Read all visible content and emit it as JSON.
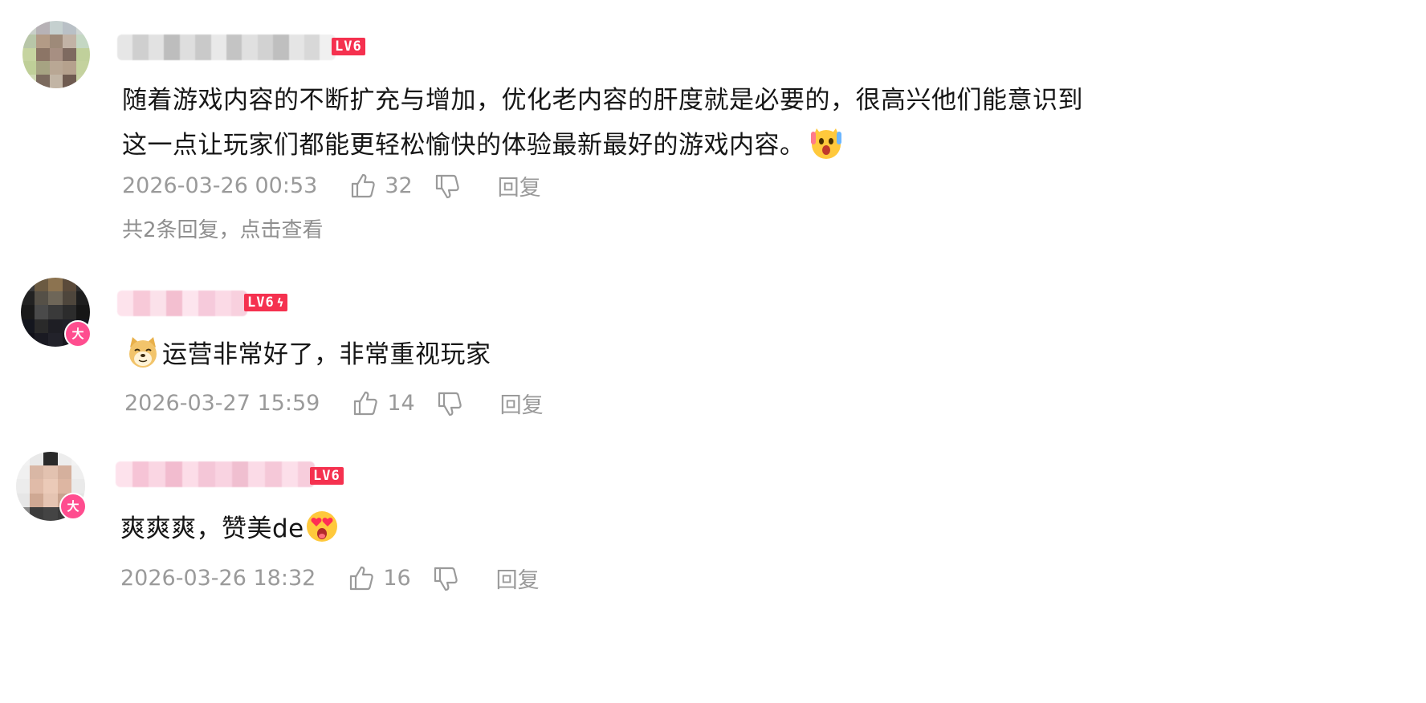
{
  "comments": [
    {
      "level": "LV6",
      "level_bolt": "",
      "big_badge": "",
      "text_lines": [
        "随着游戏内容的不断扩充与增加，优化老内容的肝度就是必要的，很高兴他们能意识到",
        "这一点让玩家们都能更轻松愉快的体验最新最好的游戏内容。"
      ],
      "trailing_emoji": "scream-cat-emoji",
      "date": "2026-03-26 00:53",
      "likes": "32",
      "reply_label": "回复",
      "replies_summary": "共2条回复，点击查看"
    },
    {
      "level": "LV6",
      "level_bolt": "ϟ",
      "big_badge": "大",
      "leading_emoji": "doge-emoji",
      "text": "运营非常好了，非常重视玩家",
      "date": "2026-03-27 15:59",
      "likes": "14",
      "reply_label": "回复"
    },
    {
      "level": "LV6",
      "level_bolt": "",
      "big_badge": "大",
      "text": "爽爽爽，赞美de",
      "trailing_emoji": "heart-eyes-scream-emoji",
      "date": "2026-03-26 18:32",
      "likes": "16",
      "reply_label": "回复"
    }
  ],
  "colors": {
    "level_badge": "#f5314f",
    "big_badge": "#ff4d8f",
    "meta_text": "#9a9a9a",
    "body_text": "#161616"
  }
}
